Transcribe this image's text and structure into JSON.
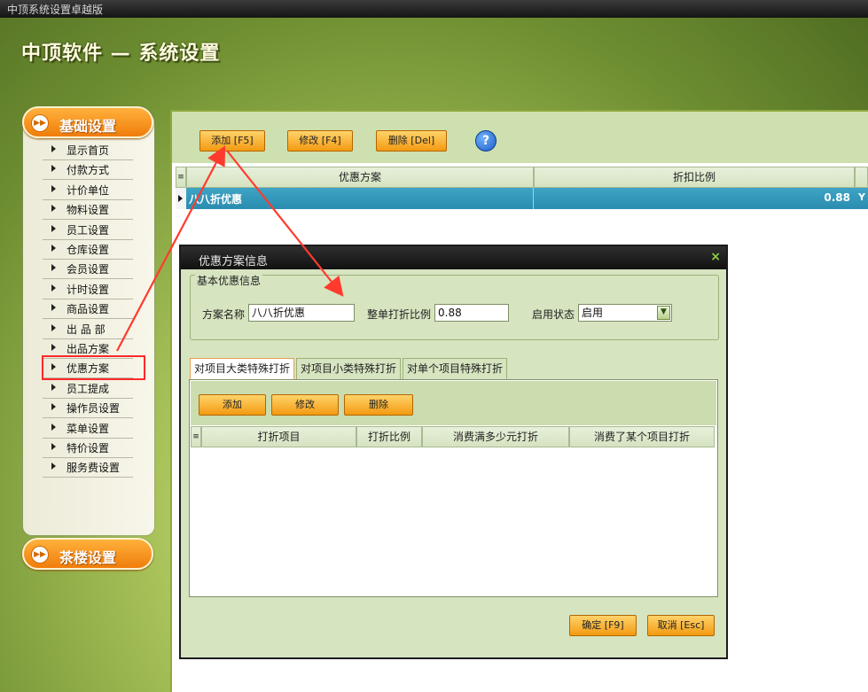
{
  "window": {
    "title": "中顶系统设置卓越版"
  },
  "banner": {
    "title": "中顶软件 — 系统设置"
  },
  "sidebar": {
    "category_basic": "基础设置",
    "category_teahouse": "茶楼设置",
    "items": [
      "显示首页",
      "付款方式",
      "计价单位",
      "物料设置",
      "员工设置",
      "仓库设置",
      "会员设置",
      "计时设置",
      "商品设置",
      "出 品 部",
      "出品方案",
      "优惠方案",
      "员工提成",
      "操作员设置",
      "菜单设置",
      "特价设置",
      "服务费设置"
    ]
  },
  "toolbar": {
    "add": "添加 [F5]",
    "edit": "修改 [F4]",
    "delete": "删除 [Del]",
    "help": "?"
  },
  "grid": {
    "columns": [
      "优惠方案",
      "折扣比例"
    ],
    "rows": [
      {
        "name": "八八折优惠",
        "ratio": "0.88",
        "extra": "Y"
      }
    ]
  },
  "dialog": {
    "title": "优惠方案信息",
    "close": "×",
    "group_label": "基本优惠信息",
    "name_label": "方案名称",
    "name_value": "八八折优惠",
    "ratio_label": "整单打折比例",
    "ratio_value": "0.88",
    "status_label": "启用状态",
    "status_value": "启用",
    "tabs": [
      "对项目大类特殊打折",
      "对项目小类特殊打折",
      "对单个项目特殊打折"
    ],
    "inner_toolbar": {
      "add": "添加",
      "edit": "修改",
      "delete": "删除"
    },
    "inner_columns": [
      "打折项目",
      "打折比例",
      "消费满多少元打折",
      "消费了某个项目打折"
    ],
    "ok": "确定 [F9]",
    "cancel": "取消 [Esc]"
  },
  "colors": {
    "accent_orange": "#f39a12",
    "selection_blue": "#2a8db0",
    "annotation_red": "#ff2a2a"
  }
}
